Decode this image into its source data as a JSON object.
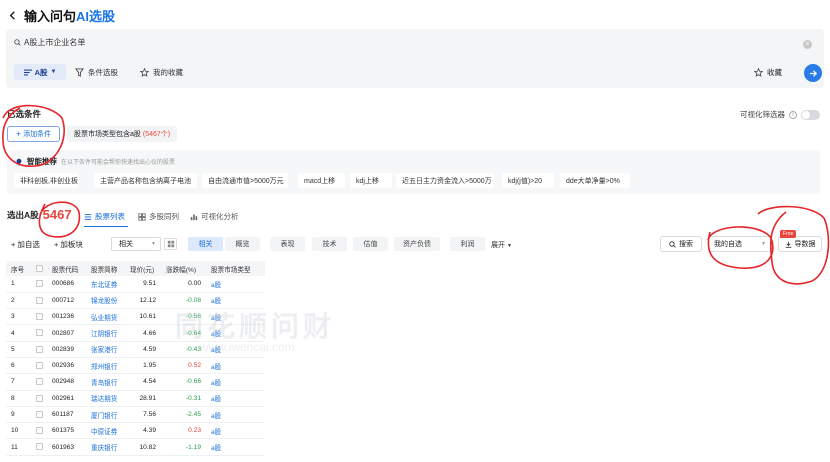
{
  "header": {
    "title_prefix": "输入问句",
    "title_ai": "AI选股"
  },
  "query": {
    "text": "A股上市企业名单"
  },
  "query_options": {
    "market": "A股",
    "condition_select": "条件选股",
    "my_favorites": "我的收藏",
    "collect": "收藏"
  },
  "selected": {
    "title": "已选条件",
    "visual_filter": "可视化筛选器",
    "add_condition": "添加条件",
    "condition": "股票市场类型包含a股",
    "condition_count": "(5467个)"
  },
  "smart": {
    "title": "智能推荐",
    "hint": "在以下条件可能会帮你快速找出心仪的股票",
    "tags": [
      "非科创板,非创业板",
      "主营产品名称包含纳离子电池",
      "自由流通市值>5000万元",
      "macd上移",
      "kdj上移",
      "近五日主力资金流入>5000万",
      "kdj(j值)>20",
      "dde大单净量>0%"
    ]
  },
  "result": {
    "label": "选出A股",
    "count": "5467",
    "views": [
      "股票列表",
      "多股同列",
      "可视化分析"
    ]
  },
  "toolbar": {
    "add_watch": "加自选",
    "add_board": "加板块",
    "select_value": "相关",
    "categories": [
      "相关",
      "概览",
      "表现",
      "技术",
      "估值",
      "资产负债",
      "利润"
    ],
    "expand": "展开",
    "search": "搜索",
    "my_watch": "我的自选",
    "export": "导数据",
    "free": "Free"
  },
  "table": {
    "headers": [
      "序号",
      "",
      "股票代码",
      "股票简称",
      "现价(元)",
      "涨跌幅(%)",
      "股票市场类型"
    ],
    "rows": [
      {
        "no": "1",
        "code": "000686",
        "name": "东北证券",
        "price": "9.51",
        "change": "0.00",
        "dir": "flat",
        "market": "a股"
      },
      {
        "no": "2",
        "code": "000712",
        "name": "锦龙股份",
        "price": "12.12",
        "change": "-0.08",
        "dir": "down",
        "market": "a股"
      },
      {
        "no": "3",
        "code": "001236",
        "name": "弘业期货",
        "price": "10.61",
        "change": "-0.56",
        "dir": "down",
        "market": "a股"
      },
      {
        "no": "4",
        "code": "002807",
        "name": "江阴银行",
        "price": "4.66",
        "change": "-0.64",
        "dir": "down",
        "market": "a股"
      },
      {
        "no": "5",
        "code": "002839",
        "name": "张家港行",
        "price": "4.59",
        "change": "-0.43",
        "dir": "down",
        "market": "a股"
      },
      {
        "no": "6",
        "code": "002936",
        "name": "郑州银行",
        "price": "1.95",
        "change": "0.52",
        "dir": "up",
        "market": "a股"
      },
      {
        "no": "7",
        "code": "002948",
        "name": "青岛银行",
        "price": "4.54",
        "change": "-0.66",
        "dir": "down",
        "market": "a股"
      },
      {
        "no": "8",
        "code": "002961",
        "name": "瑞达期货",
        "price": "28.91",
        "change": "-0.31",
        "dir": "down",
        "market": "a股"
      },
      {
        "no": "9",
        "code": "601187",
        "name": "厦门银行",
        "price": "7.56",
        "change": "-2.45",
        "dir": "down",
        "market": "a股"
      },
      {
        "no": "10",
        "code": "601375",
        "name": "中原证券",
        "price": "4.39",
        "change": "0.23",
        "dir": "up",
        "market": "a股"
      },
      {
        "no": "11",
        "code": "601963",
        "name": "重庆银行",
        "price": "10.82",
        "change": "-1.19",
        "dir": "down",
        "market": "a股"
      }
    ]
  },
  "watermark": {
    "main": "同花顺问财",
    "sub": "www.iwencai.com"
  },
  "colors": {
    "accent": "#1a6fd8",
    "up": "#e8453c",
    "down": "#2c9a4a",
    "annotation": "#e5252a"
  }
}
